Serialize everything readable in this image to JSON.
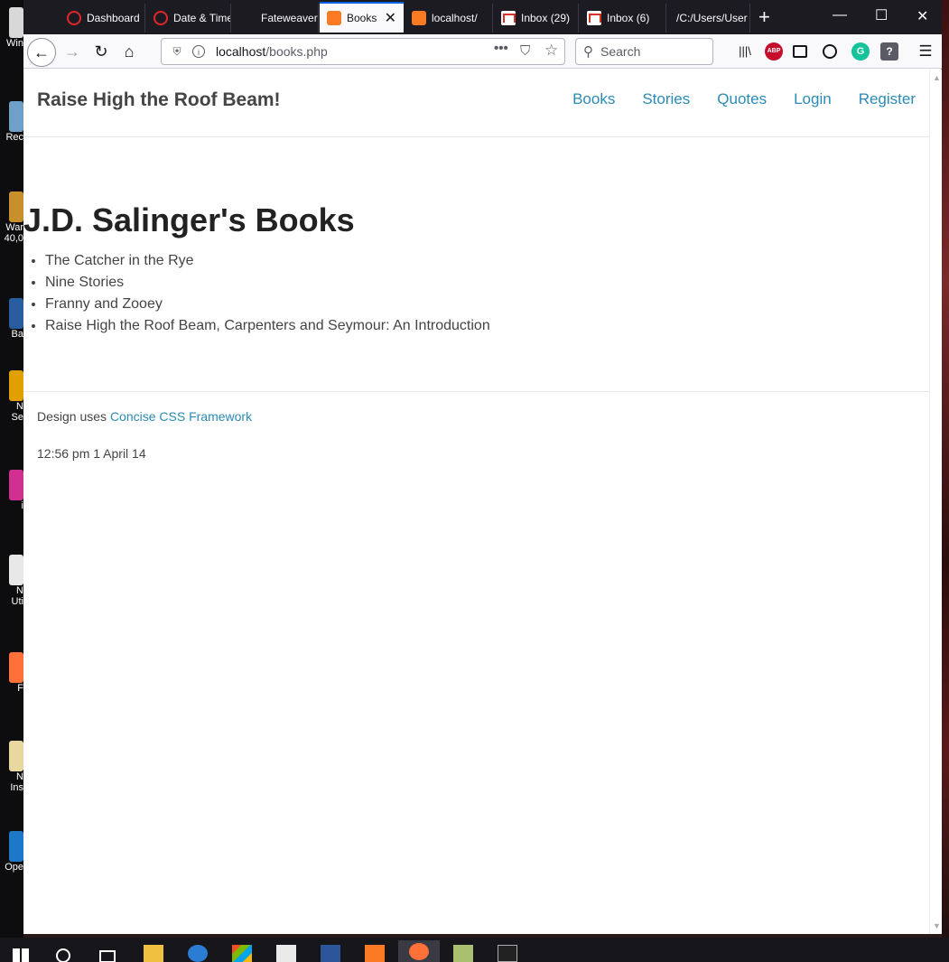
{
  "desktop": {
    "icons": [
      {
        "label": "Win",
        "color": "#d8d8d8"
      },
      {
        "label": "Rec",
        "color": "#6fa0c8"
      },
      {
        "label": "War\n40,0",
        "color": "#c8902a"
      },
      {
        "label": "Ba",
        "color": "#2a5ca0"
      },
      {
        "label": "N\nSe",
        "color": "#e0a000"
      },
      {
        "label": "i",
        "color": "#d03090"
      },
      {
        "label": "N\nUti",
        "color": "#e8e8e8"
      },
      {
        "label": "F",
        "color": "#ff7139"
      },
      {
        "label": "N\nIns",
        "color": "#e8d8a0"
      },
      {
        "label": "Ope",
        "color": "#1e78c8"
      }
    ]
  },
  "tabs": [
    {
      "label": "Dashboard",
      "favicon": "opera-icon",
      "active": false
    },
    {
      "label": "Date & Time",
      "favicon": "opera-icon",
      "active": false
    },
    {
      "label": "Fateweaver",
      "favicon": "dark-icon",
      "active": false
    },
    {
      "label": "Books",
      "favicon": "xampp-icon",
      "active": true
    },
    {
      "label": "localhost/",
      "favicon": "xampp-icon",
      "active": false
    },
    {
      "label": "Inbox (29)",
      "favicon": "gmail-icon",
      "active": false
    },
    {
      "label": "Inbox (6)",
      "favicon": "gmail-icon",
      "active": false
    },
    {
      "label": "/C:/Users/User",
      "favicon": "none",
      "active": false
    }
  ],
  "toolbar": {
    "url_host": "localhost",
    "url_path": "/books.php",
    "search_placeholder": "Search"
  },
  "site": {
    "title": "Raise High the Roof Beam!",
    "nav": [
      "Books",
      "Stories",
      "Quotes",
      "Login",
      "Register"
    ],
    "heading": "J.D. Salinger's Books",
    "books": [
      "The Catcher in the Rye",
      "Nine Stories",
      "Franny and Zooey",
      "Raise High the Roof Beam, Carpenters and Seymour: An Introduction"
    ],
    "footer": {
      "credit_prefix": "Design uses ",
      "credit_link": "Concise CSS Framework",
      "timestamp": "12:56 pm 1 April 14"
    }
  },
  "colors": {
    "link": "#2b8bb4",
    "tabbar_bg": "#1c1b22",
    "active_tab_accent": "#0061e0"
  }
}
